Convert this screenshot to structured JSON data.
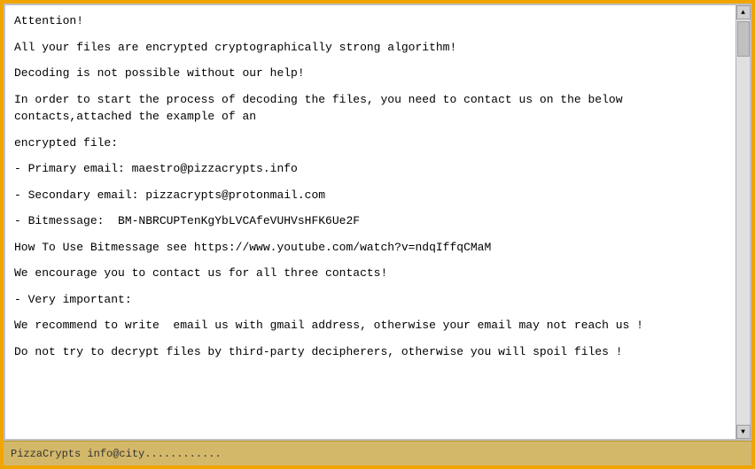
{
  "content": {
    "lines": [
      {
        "id": "line1",
        "text": "Attention!"
      },
      {
        "id": "line2",
        "text": ""
      },
      {
        "id": "line3",
        "text": "All your files are encrypted cryptographically strong algorithm!"
      },
      {
        "id": "line4",
        "text": ""
      },
      {
        "id": "line5",
        "text": "Decoding is not possible without our help!"
      },
      {
        "id": "line6",
        "text": ""
      },
      {
        "id": "line7",
        "text": "In order to start the process of decoding the files, you need to contact us on the below"
      },
      {
        "id": "line8",
        "text": "contacts,attached the example of an"
      },
      {
        "id": "line9",
        "text": ""
      },
      {
        "id": "line10",
        "text": "encrypted file:"
      },
      {
        "id": "line11",
        "text": ""
      },
      {
        "id": "line12",
        "text": "- Primary email: maestro@pizzacrypts.info"
      },
      {
        "id": "line13",
        "text": ""
      },
      {
        "id": "line14",
        "text": "- Secondary email: pizzacrypts@protonmail.com"
      },
      {
        "id": "line15",
        "text": ""
      },
      {
        "id": "line16",
        "text": "- Bitmessage:  BM-NBRCUPTenKgYbLVCAfeVUHVsHFK6Ue2F"
      },
      {
        "id": "line17",
        "text": ""
      },
      {
        "id": "line18",
        "text": "How To Use Bitmessage see https://www.youtube.com/watch?v=ndqIffqCMaM"
      },
      {
        "id": "line19",
        "text": ""
      },
      {
        "id": "line20",
        "text": "We encourage you to contact us for all three contacts!"
      },
      {
        "id": "line21",
        "text": ""
      },
      {
        "id": "line22",
        "text": "- Very important:"
      },
      {
        "id": "line23",
        "text": ""
      },
      {
        "id": "line24",
        "text": "We recommend to write  email us with gmail address, otherwise your email may not reach us !"
      },
      {
        "id": "line25",
        "text": ""
      },
      {
        "id": "line26",
        "text": "Do not try to decrypt files by third-party decipherers, otherwise you will spoil files !"
      }
    ],
    "footer_text": "PizzaCrypts  info@city............"
  },
  "scrollbar": {
    "up_arrow": "▲",
    "down_arrow": "▼"
  }
}
